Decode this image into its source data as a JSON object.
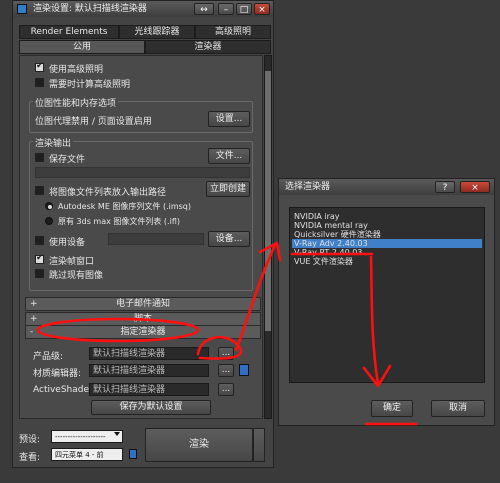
{
  "main_window": {
    "title": "渲染设置: 默认扫描线渲染器",
    "title_buttons": {
      "swap": "↔",
      "minimize": "–",
      "maximize": "□",
      "close": "×"
    },
    "tabs_row1": [
      "Render Elements",
      "光线跟踪器",
      "高级照明"
    ],
    "tabs_row2": [
      "公用",
      "渲染器"
    ],
    "checkboxes_top": [
      {
        "label": "使用高级照明",
        "checked": true
      },
      {
        "label": "需要时计算高级照明",
        "checked": false
      }
    ],
    "bitmap_group": {
      "title": "位图性能和内存选项",
      "label": "位图代理禁用 / 页面设置启用",
      "button": "设置..."
    },
    "render_output": {
      "title": "渲染输出",
      "save_file": "保存文件",
      "files_button": "文件...",
      "put_list": "将图像文件列表放入输出路径",
      "create_now": "立即创建",
      "radio1": "Autodesk ME 图像序列文件 (.imsq)",
      "radio2": "原有 3ds max 图像文件列表 (.ifl)",
      "use_device": "使用设备",
      "devices_button": "设备...",
      "render_frame_window": "渲染帧窗口",
      "skip_existing": "跳过现有图像"
    },
    "rollouts": {
      "email": "电子邮件通知",
      "script": "脚本",
      "assign": "指定渲染器"
    },
    "assign": {
      "production_label": "产品级:",
      "production_value": "默认扫描线渲染器",
      "material_label": "材质编辑器:",
      "material_value": "默认扫描线渲染器",
      "activeshade_label": "ActiveShade:",
      "activeshade_value": "默认扫描线渲染器",
      "save_default": "保存为默认设置",
      "more": "...",
      "lock_icon": "lock-icon"
    },
    "bottom": {
      "preset_label": "预设:",
      "preset_value": "--------------------",
      "view_label": "查看:",
      "view_value": "四元菜单 4 - 前",
      "render_button": "渲染"
    },
    "plus": "+",
    "minus": "-"
  },
  "dialog": {
    "title": "选择渲染器",
    "help": "?",
    "close": "×",
    "items": [
      "NVIDIA iray",
      "NVIDIA mental ray",
      "Quicksilver 硬件渲染器",
      "V-Ray Adv 2.40.03",
      "V-Ray RT 2.40.03",
      "VUE 文件渲染器"
    ],
    "selected_index": 3,
    "ok": "确定",
    "cancel": "取消"
  },
  "annotation_color": "#ff1010"
}
